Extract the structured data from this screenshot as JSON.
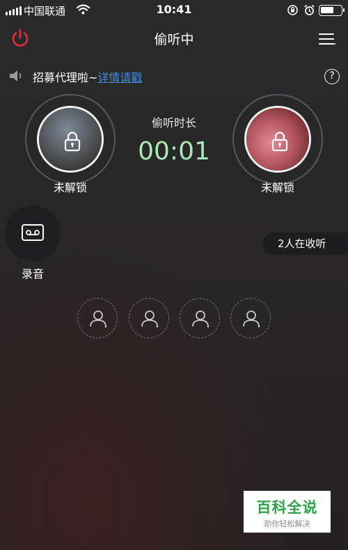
{
  "status_bar": {
    "carrier": "中国联通",
    "time": "10:41"
  },
  "header": {
    "title": "偷听中",
    "power_icon": "power-icon",
    "menu_icon": "menu-icon"
  },
  "notice": {
    "text": "招募代理啦~",
    "link": "详情请戳",
    "icon": "speaker-icon",
    "help_label": "?"
  },
  "timer": {
    "label": "偷听时长",
    "value": "00:01"
  },
  "left_user": {
    "label": "未解锁"
  },
  "right_user": {
    "label": "未解锁"
  },
  "record": {
    "label": "录音",
    "icon": "cassette-icon"
  },
  "listeners": {
    "text": "2人在收听"
  },
  "seats": [
    {
      "icon": "user-icon"
    },
    {
      "icon": "user-icon"
    },
    {
      "icon": "user-icon"
    },
    {
      "icon": "user-icon"
    }
  ],
  "watermark": {
    "main": "百科全说",
    "sub": "助你轻松解决"
  },
  "colors": {
    "accent_red": "#e0303a",
    "link_blue": "#3f8fe8",
    "timer_green": "#a9e7b6"
  }
}
